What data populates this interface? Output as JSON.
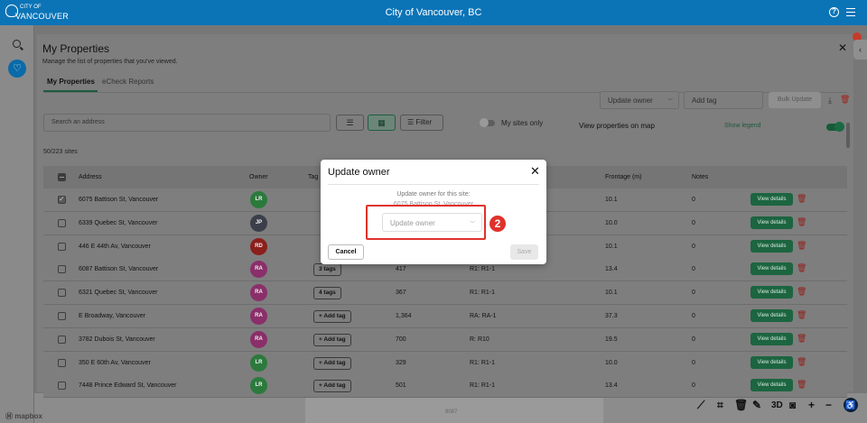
{
  "topbar": {
    "logo_line1": "CITY OF",
    "logo_line2": "VANCOUVER",
    "title": "City of Vancouver, BC",
    "help_icon": "?"
  },
  "panel": {
    "title": "My Properties",
    "subtitle": "Manage the list of properties that you've viewed.",
    "tabs": [
      {
        "label": "My Properties",
        "active": true
      },
      {
        "label": "eCheck Reports",
        "active": false
      }
    ],
    "update_owner_placeholder": "Update owner",
    "add_tag_placeholder": "Add tag",
    "bulk_update_label": "Bulk Update",
    "search_placeholder": "Search an address",
    "filter_label": "Filter",
    "my_sites_only_label": "My sites only",
    "view_on_map_label": "View properties on map",
    "show_legend_label": "Show legend",
    "site_count": "50/223 sites"
  },
  "table": {
    "headers": {
      "address": "Address",
      "owner": "Owner",
      "tags": "Tag",
      "frontage": "Frontage (m)",
      "notes": "Notes"
    },
    "rows": [
      {
        "address": "6075 Battison St, Vancouver",
        "owner": "LR",
        "owner_color": "#2b7a3c",
        "tag": "",
        "area": "",
        "zone": "",
        "frontage": "10.1",
        "notes": "0",
        "checked": true
      },
      {
        "address": "6339 Quebec St, Vancouver",
        "owner": "JP",
        "owner_color": "#3b3f4a",
        "tag": "",
        "area": "",
        "zone": "",
        "frontage": "10.0",
        "notes": "0",
        "checked": false
      },
      {
        "address": "446 E 44th Av, Vancouver",
        "owner": "RD",
        "owner_color": "#8b1f1b",
        "tag": "",
        "area": "",
        "zone": "",
        "frontage": "10.1",
        "notes": "0",
        "checked": false
      },
      {
        "address": "6087 Battison St, Vancouver",
        "owner": "RA",
        "owner_color": "#8a2f6a",
        "tag": "3 tags",
        "area": "417",
        "zone": "R1: R1-1",
        "frontage": "13.4",
        "notes": "0",
        "checked": false
      },
      {
        "address": "6321 Quebec St, Vancouver",
        "owner": "RA",
        "owner_color": "#8a2f6a",
        "tag": "4 tags",
        "area": "367",
        "zone": "R1: R1-1",
        "frontage": "10.1",
        "notes": "0",
        "checked": false
      },
      {
        "address": "E Broadway, Vancouver",
        "owner": "RA",
        "owner_color": "#8a2f6a",
        "tag": "+ Add tag",
        "area": "1,364",
        "zone": "RA: RA-1",
        "frontage": "37.3",
        "notes": "0",
        "checked": false
      },
      {
        "address": "3782 Dubois St, Vancouver",
        "owner": "RA",
        "owner_color": "#8a2f6a",
        "tag": "+ Add tag",
        "area": "700",
        "zone": "R: R10",
        "frontage": "19.5",
        "notes": "0",
        "checked": false
      },
      {
        "address": "350 E 60th Av, Vancouver",
        "owner": "LR",
        "owner_color": "#2b7a3c",
        "tag": "+ Add tag",
        "area": "329",
        "zone": "R1: R1-1",
        "frontage": "10.0",
        "notes": "0",
        "checked": false
      },
      {
        "address": "7448 Prince Edward St, Vancouver",
        "owner": "LR",
        "owner_color": "#2b7a3c",
        "tag": "+ Add tag",
        "area": "501",
        "zone": "R1: R1-1",
        "frontage": "13.4",
        "notes": "0",
        "checked": false
      }
    ],
    "view_details_label": "View details"
  },
  "dialog": {
    "title": "Update owner",
    "line1": "Update owner for this site:",
    "line2": "6075 Battison St, Vancouver",
    "select_placeholder": "Update owner",
    "cancel_label": "Cancel",
    "save_label": "Save"
  },
  "annotation": {
    "step_number": "2",
    "color": "#e0322b"
  },
  "map": {
    "attribution": "mapbox",
    "parcel_number": "8087",
    "tools": {
      "three_d_label": "3D",
      "zoom_in_label": "+",
      "zoom_out_label": "−"
    }
  },
  "colors": {
    "brand_blue": "#0b74b7",
    "accent_green": "#1c6540",
    "danger_red": "#a3201b"
  }
}
